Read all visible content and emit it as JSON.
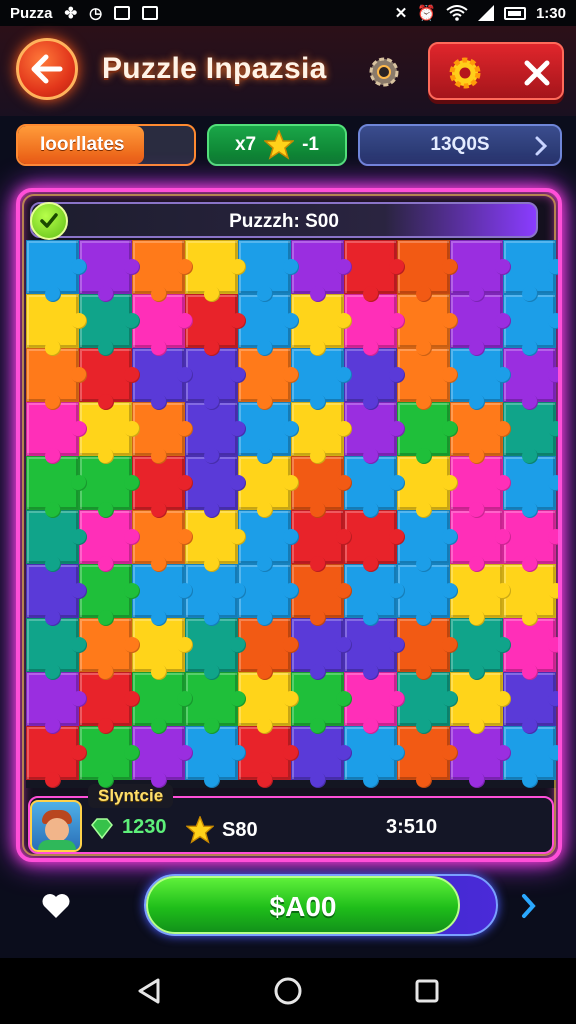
{
  "status_bar": {
    "app_label": "Puz⁠ᴢa",
    "time": "1:30",
    "icons": [
      "app-icon",
      "clock-icon",
      "photo-icon",
      "media-icon",
      "mute-icon",
      "alarm-icon",
      "wifi-icon",
      "signal-icon",
      "battery-icon"
    ]
  },
  "header": {
    "title": "Puzzle Inpazsia",
    "back_icon": "arrow-left-icon",
    "hint_icon": "gear-icon",
    "settings_icon": "gear-icon",
    "close_icon": "close-icon"
  },
  "tabs": [
    {
      "label": "Ioorllates"
    },
    {
      "label_left": "x7",
      "label_right": "-1",
      "icon": "star-icon"
    },
    {
      "label": "13Q0S",
      "icon": "chevron-right-icon"
    }
  ],
  "puzzle": {
    "progress_label": "Puzzzh: S00",
    "progress_icon": "check-icon",
    "colors": [
      "#e8232a",
      "#ff7a1a",
      "#ffd41a",
      "#1fbf3a",
      "#1c9ee8",
      "#9a2ee0",
      "#ff2fb8",
      "#10a48a",
      "#f25a14",
      "#5a3ad8"
    ]
  },
  "player": {
    "name": "Slyntcie",
    "gems": "1230",
    "stars": "S80",
    "time": "3:510",
    "gem_icon": "gem-icon",
    "star_icon": "star-icon"
  },
  "bottom": {
    "buy_label": "$A00",
    "heart_icon": "heart-icon",
    "next_icon": "chevron-right-icon"
  },
  "nav": {
    "icons": [
      "back-triangle-icon",
      "home-circle-icon",
      "recents-square-icon"
    ]
  },
  "colors": {
    "panel_border": "#ff4fd8",
    "header_button": "#e0262c",
    "primary_button": "#1fbe1a"
  }
}
